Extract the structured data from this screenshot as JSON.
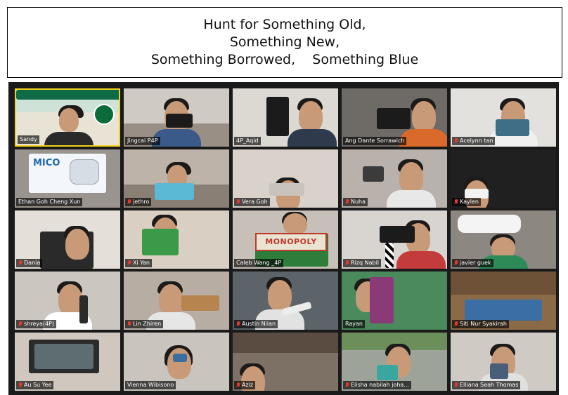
{
  "title": {
    "line1": "Hunt for Something Old,",
    "line2": "Something New,",
    "line3": "Something Borrowed,    Something Blue"
  },
  "gallery": {
    "rows": [
      [
        {
          "name": "Sandy",
          "muted": false,
          "active": true
        },
        {
          "name": "Jingcai P4P",
          "muted": false
        },
        {
          "name": "4P_Aqid",
          "muted": false
        },
        {
          "name": "Ang Dante Sorrawich",
          "muted": false
        },
        {
          "name": "Acelynn tan",
          "muted": true
        }
      ],
      [
        {
          "name": "Ethan Goh Cheng Xun",
          "muted": false,
          "sign": "MICO"
        },
        {
          "name": "jethro",
          "muted": true
        },
        {
          "name": "Vera Goh",
          "muted": true
        },
        {
          "name": "Nuha",
          "muted": true
        },
        {
          "name": "Kaylen",
          "muted": true
        }
      ],
      [
        {
          "name": "Dania",
          "muted": true
        },
        {
          "name": "Xi Yan",
          "muted": true
        },
        {
          "name": "Caleb Wang _4P",
          "muted": false,
          "sign": "MONOPOLY"
        },
        {
          "name": "Rizq Nabil",
          "muted": true
        },
        {
          "name": "javier guek",
          "muted": true
        }
      ],
      [
        {
          "name": "shreya(4P)",
          "muted": true
        },
        {
          "name": "Lin Zhiren",
          "muted": true
        },
        {
          "name": "Austin Nilan",
          "muted": true
        },
        {
          "name": "Rayan",
          "muted": false
        },
        {
          "name": "Siti Nur Syakirah",
          "muted": true
        }
      ],
      [
        {
          "name": "Au Su Yee",
          "muted": true
        },
        {
          "name": "Vienna Wibisono",
          "muted": false
        },
        {
          "name": "Aziz",
          "muted": true
        },
        {
          "name": "Elisha nabilah joha...",
          "muted": true
        },
        {
          "name": "Elliana Seah Thomas",
          "muted": true
        }
      ]
    ],
    "colors": {
      "active_border": "#f2d21a",
      "muted_icon": "#e23a2e",
      "gallery_bg": "#1a1a1a"
    }
  }
}
